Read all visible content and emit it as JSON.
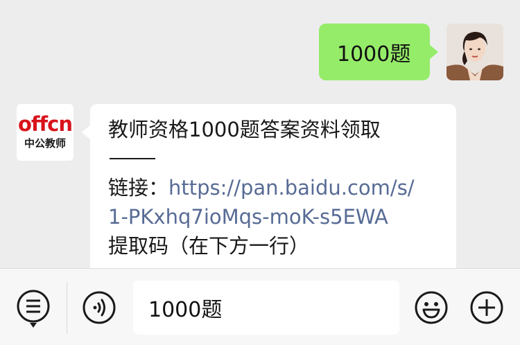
{
  "messages": {
    "outgoing": {
      "text": "1000题"
    },
    "incoming": {
      "sender_logo_top": "offcn",
      "sender_logo_bottom": "中公教师",
      "title": "教师资格1000题答案资料领取",
      "link_prefix": "链接：",
      "link_part1": "https://pan.baidu.com/s/",
      "link_part2": "1-PKxhq7ioMqs-moK-s5EWA",
      "code_line": "提取码（在下方一行）"
    }
  },
  "input_bar": {
    "text_value": "1000题",
    "icons": [
      "menu-icon",
      "voice-icon",
      "emoji-icon",
      "plus-icon"
    ]
  },
  "colors": {
    "background": "#ededed",
    "outgoing_bubble": "#95ec69",
    "incoming_bubble": "#ffffff",
    "link": "#576b95",
    "logo_red": "#d8131b"
  }
}
